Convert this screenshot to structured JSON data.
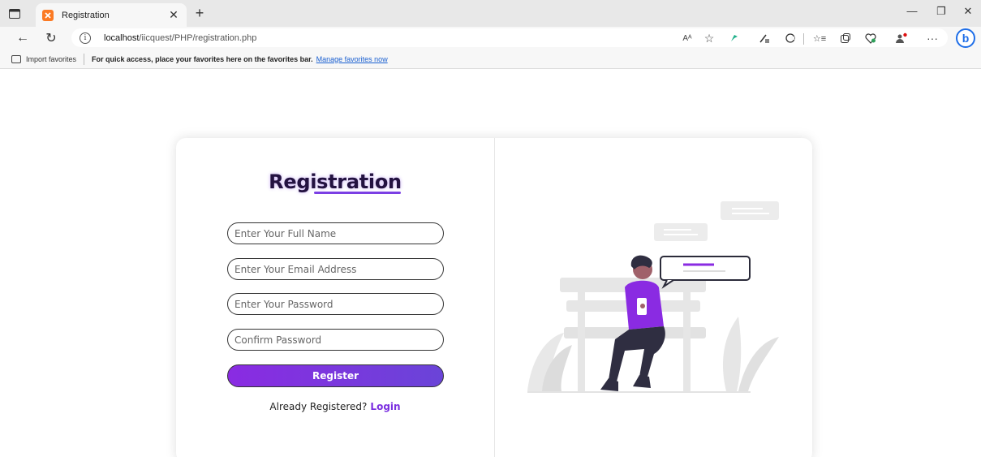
{
  "browser": {
    "tab_title": "Registration",
    "url_host": "localhost",
    "url_path": "/iicquest/PHP/registration.php",
    "read_aloud_label": "Aᴬ"
  },
  "favorites_bar": {
    "import_label": "Import favorites",
    "hint": "For quick access, place your favorites here on the favorites bar.",
    "manage_link": "Manage favorites now"
  },
  "form": {
    "title": "Registration",
    "full_name_placeholder": "Enter Your Full Name",
    "email_placeholder": "Enter Your Email Address",
    "password_placeholder": "Enter Your Password",
    "confirm_placeholder": "Confirm Password",
    "register_label": "Register",
    "already_text": "Already Registered?",
    "login_label": "Login"
  },
  "colors": {
    "accent": "#8a2be2",
    "accent_end": "#6a44d8",
    "link_purple": "#7b2fe0",
    "illustration_gray": "#e6e6e6"
  },
  "icons": [
    "sidebar-icon",
    "xampp-icon",
    "back-icon",
    "refresh-icon",
    "info-icon",
    "read-aloud-icon",
    "favorite-star-icon",
    "extension-icon",
    "pen-icon",
    "settings-icon",
    "favorites-icon",
    "collections-icon",
    "health-icon",
    "profile-icon",
    "more-icon",
    "bing-icon"
  ]
}
